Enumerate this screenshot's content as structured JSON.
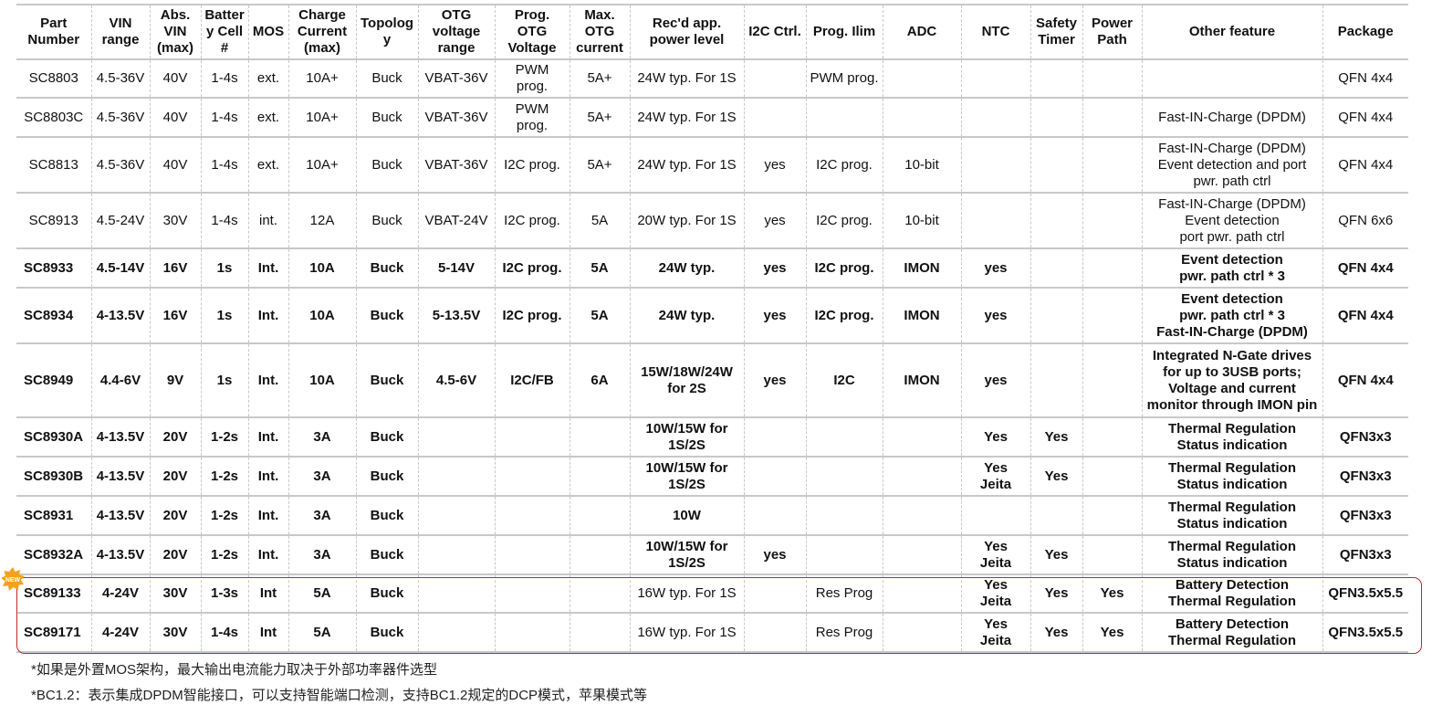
{
  "headers": [
    "Part\nNumber",
    "VIN\nrange",
    "Abs.\nVIN\n(max)",
    "Batter\ny Cell\n#",
    "MOS",
    "Charge\nCurrent\n(max)",
    "Topolog\ny",
    "OTG\nvoltage\nrange",
    "Prog.\nOTG\nVoltage",
    "Max.\nOTG\ncurrent",
    "Rec'd app.\npower level",
    "I2C Ctrl.",
    "Prog. Ilim",
    "ADC",
    "NTC",
    "Safety\nTimer",
    "Power\nPath",
    "Other feature",
    "Package"
  ],
  "rows": [
    {
      "bold": false,
      "cells": [
        "SC8803",
        "4.5-36V",
        "40V",
        "1-4s",
        "ext.",
        "10A+",
        "Buck",
        "VBAT-36V",
        "PWM\nprog.",
        "5A+",
        "24W typ. For 1S",
        "",
        "PWM prog.",
        "",
        "",
        "",
        "",
        "",
        "QFN 4x4"
      ]
    },
    {
      "bold": false,
      "cells": [
        "SC8803C",
        "4.5-36V",
        "40V",
        "1-4s",
        "ext.",
        "10A+",
        "Buck",
        "VBAT-36V",
        "PWM\nprog.",
        "5A+",
        "24W typ. For 1S",
        "",
        "",
        "",
        "",
        "",
        "",
        "Fast-IN-Charge (DPDM)",
        "QFN 4x4"
      ]
    },
    {
      "bold": false,
      "cells": [
        "SC8813",
        "4.5-36V",
        "40V",
        "1-4s",
        "ext.",
        "10A+",
        "Buck",
        "VBAT-36V",
        "I2C prog.",
        "5A+",
        "24W typ. For 1S",
        "yes",
        "I2C prog.",
        "10-bit",
        "",
        "",
        "",
        "Fast-IN-Charge (DPDM)\nEvent detection and port\npwr. path ctrl",
        "QFN 4x4"
      ]
    },
    {
      "bold": false,
      "cells": [
        "SC8913",
        "4.5-24V",
        "30V",
        "1-4s",
        "int.",
        "12A",
        "Buck",
        "VBAT-24V",
        "I2C prog.",
        "5A",
        "20W typ. For 1S",
        "yes",
        "I2C prog.",
        "10-bit",
        "",
        "",
        "",
        "Fast-IN-Charge (DPDM)\nEvent detection\nport pwr. path ctrl",
        "QFN 6x6"
      ]
    },
    {
      "bold": true,
      "cells": [
        "SC8933",
        "4.5-14V",
        "16V",
        "1s",
        "Int.",
        "10A",
        "Buck",
        "5-14V",
        "I2C prog.",
        "5A",
        "24W typ.",
        "yes",
        "I2C prog.",
        "IMON",
        "yes",
        "",
        "",
        "Event detection\npwr. path ctrl * 3",
        "QFN 4x4"
      ]
    },
    {
      "bold": true,
      "cells": [
        "SC8934",
        "4-13.5V",
        "16V",
        "1s",
        "Int.",
        "10A",
        "Buck",
        "5-13.5V",
        "I2C prog.",
        "5A",
        "24W typ.",
        "yes",
        "I2C prog.",
        "IMON",
        "yes",
        "",
        "",
        "Event detection\npwr. path ctrl * 3\nFast-IN-Charge (DPDM)",
        "QFN 4x4"
      ]
    },
    {
      "bold": true,
      "cells": [
        "SC8949",
        "4.4-6V",
        "9V",
        "1s",
        "Int.",
        "10A",
        "Buck",
        "4.5-6V",
        "I2C/FB",
        "6A",
        "15W/18W/24W\nfor 2S",
        "yes",
        "I2C",
        "IMON",
        "yes",
        "",
        "",
        "Integrated N-Gate drives\nfor up to 3USB ports;\nVoltage and current\nmonitor through IMON pin",
        "QFN 4x4"
      ]
    },
    {
      "bold": true,
      "cells": [
        "SC8930A",
        "4-13.5V",
        "20V",
        "1-2s",
        "Int.",
        "3A",
        "Buck",
        "",
        "",
        "",
        "10W/15W for\n1S/2S",
        "",
        "",
        "",
        "Yes",
        "Yes",
        "",
        "Thermal Regulation\nStatus indication",
        "QFN3x3"
      ]
    },
    {
      "bold": true,
      "cells": [
        "SC8930B",
        "4-13.5V",
        "20V",
        "1-2s",
        "Int.",
        "3A",
        "Buck",
        "",
        "",
        "",
        "10W/15W for\n1S/2S",
        "",
        "",
        "",
        "Yes\nJeita",
        "Yes",
        "",
        "Thermal Regulation\nStatus indication",
        "QFN3x3"
      ]
    },
    {
      "bold": true,
      "cells": [
        "SC8931",
        "4-13.5V",
        "20V",
        "1-2s",
        "Int.",
        "3A",
        "Buck",
        "",
        "",
        "",
        "10W",
        "",
        "",
        "",
        "",
        "",
        "",
        "Thermal Regulation\nStatus indication",
        "QFN3x3"
      ]
    },
    {
      "bold": true,
      "cells": [
        "SC8932A",
        "4-13.5V",
        "20V",
        "1-2s",
        "Int.",
        "3A",
        "Buck",
        "",
        "",
        "",
        "10W/15W for\n1S/2S",
        "yes",
        "",
        "",
        "Yes\nJeita",
        "Yes",
        "",
        "Thermal Regulation\nStatus indication",
        "QFN3x3"
      ]
    },
    {
      "bold": true,
      "cells": [
        "SC89133",
        "4-24V",
        "30V",
        "1-3s",
        "Int",
        "5A",
        "Buck",
        "",
        "",
        "",
        "16W typ. For 1S",
        "",
        "Res Prog",
        "",
        "Yes\nJeita",
        "Yes",
        "Yes",
        "Battery Detection\nThermal Regulation",
        "QFN3.5x5.5"
      ]
    },
    {
      "bold": true,
      "cells": [
        "SC89171",
        "4-24V",
        "30V",
        "1-4s",
        "Int",
        "5A",
        "Buck",
        "",
        "",
        "",
        "16W typ. For 1S",
        "",
        "Res Prog",
        "",
        "Yes\nJeita",
        "Yes",
        "Yes",
        "Battery Detection\nThermal Regulation",
        "QFN3.5x5.5"
      ]
    }
  ],
  "normal_weight_columns": [
    10,
    12
  ],
  "badge_text": "NEW",
  "notes": [
    "*如果是外置MOS架构，最大输出电流能力取决于外部功率器件选型",
    "*BC1.2：表示集成DPDM智能接口，可以支持智能端口检测，支持BC1.2规定的DCP模式，苹果模式等"
  ],
  "colors": {
    "highlight": "#c0292b",
    "badge": "#f2a31b",
    "grid": "#c8c8c8"
  }
}
